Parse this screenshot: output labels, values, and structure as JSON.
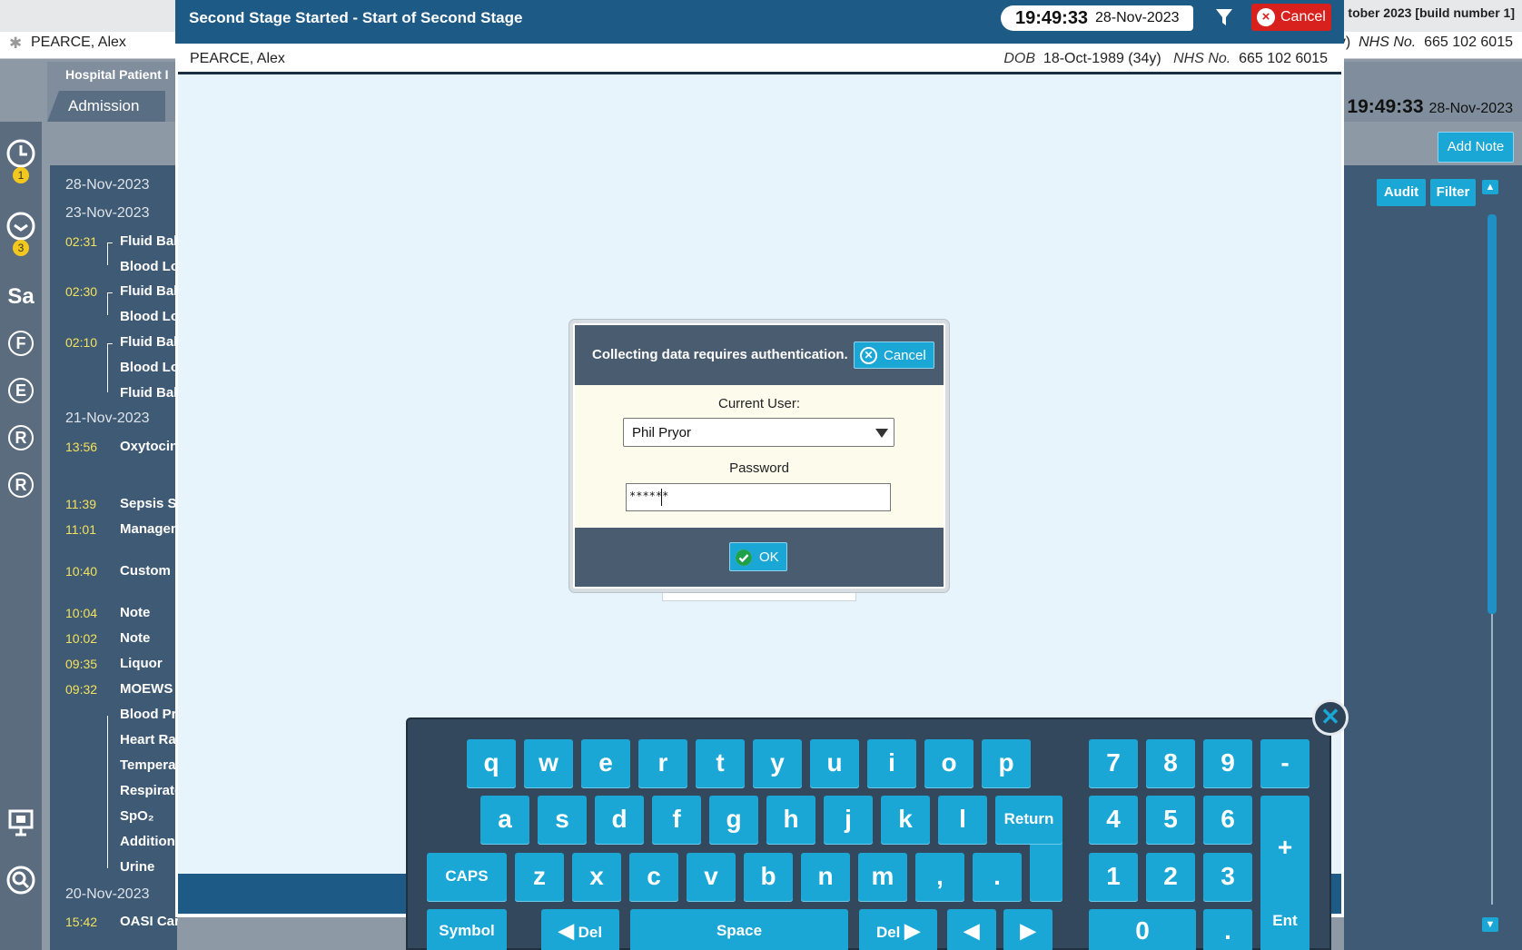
{
  "background": {
    "build_text": "tober 2023 [build number 1]",
    "patient_name": "PEARCE, Alex",
    "nhs_prefix": "y)",
    "nhs_label": "NHS No.",
    "nhs_value": "665 102 6015",
    "hospital_label": "Hospital Patient I",
    "admission_tab": "Admission",
    "clock_time": "19:49:33",
    "clock_date": "28-Nov-2023",
    "add_note": "Add Note",
    "audit": "Audit",
    "filter": "Filter",
    "sidebar": {
      "badge1": "1",
      "badge2": "3",
      "sa": "Sa",
      "f": "F",
      "e": "E",
      "r1": "R",
      "r2": "R"
    },
    "timeline": {
      "d1": "28-Nov-2023",
      "d2": "23-Nov-2023",
      "d3": "21-Nov-2023",
      "d4": "20-Nov-2023",
      "t0231": "02:31",
      "t0230": "02:30",
      "t0210": "02:10",
      "t1356": "13:56",
      "t1139": "11:39",
      "t1101": "11:01",
      "t1040": "10:40",
      "t1004": "10:04",
      "t1002": "10:02",
      "t0935": "09:35",
      "t0932": "09:32",
      "t1542": "15:42",
      "i_fluid": "Fluid Bala",
      "i_blood": "Blood Lo",
      "i_oxy": "Oxytocin",
      "i_sepsis": "Sepsis Si",
      "i_manage": "Managem",
      "i_custom": "Custom F",
      "i_note": "Note",
      "i_liquor": "Liquor",
      "i_moews": "MOEWS",
      "i_bp": "Blood Pre",
      "i_hr": "Heart Rat",
      "i_temp": "Temperat",
      "i_resp": "Respirato",
      "i_spo2": "SpO₂",
      "i_add": "Additiona",
      "i_urine": "Urine",
      "i_oasi": "OASI Care Bundle"
    }
  },
  "modal": {
    "title": "Second Stage Started - Start of Second Stage",
    "clock_time": "19:49:33",
    "clock_date": "28-Nov-2023",
    "cancel": "Cancel",
    "patient_name": "PEARCE, Alex",
    "dob_label": "DOB",
    "dob_value": "18-Oct-1989 (34y)",
    "nhs_label": "NHS No.",
    "nhs_value": "665 102 6015"
  },
  "auth": {
    "message": "Collecting data requires authentication.",
    "cancel": "Cancel",
    "user_label": "Current User:",
    "user_value": "Phil Pryor",
    "password_label": "Password",
    "password_value": "******",
    "ok": "OK"
  },
  "keyboard": {
    "row1": [
      "q",
      "w",
      "e",
      "r",
      "t",
      "y",
      "u",
      "i",
      "o",
      "p"
    ],
    "row2": [
      "a",
      "s",
      "d",
      "f",
      "g",
      "h",
      "j",
      "k",
      "l"
    ],
    "row3": [
      "z",
      "x",
      "c",
      "v",
      "b",
      "n",
      "m",
      ",",
      "."
    ],
    "return": "Return",
    "caps": "CAPS",
    "symbol": "Symbol",
    "del_left": "Del",
    "space": "Space",
    "del_right": "Del",
    "numpad": [
      "7",
      "8",
      "9",
      "-",
      "4",
      "5",
      "6",
      "+",
      "1",
      "2",
      "3",
      "0",
      "."
    ],
    "ent": "Ent"
  },
  "colors": {
    "accent": "#1aa7d6",
    "title_bar": "#1e5a86",
    "cancel_red": "#d8201c",
    "time_yellow": "#f4e25d",
    "dialog_bg": "#fdfbec"
  }
}
